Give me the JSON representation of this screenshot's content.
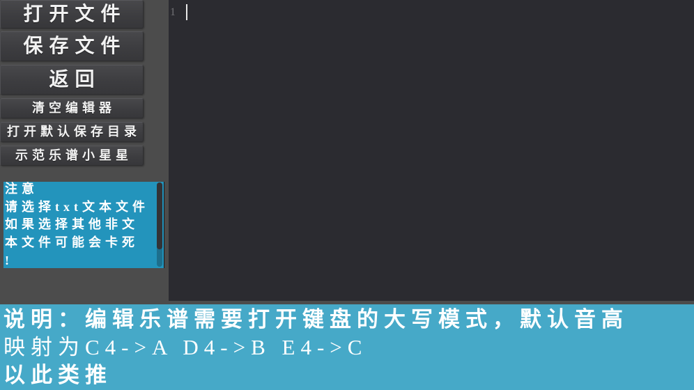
{
  "sidebar": {
    "buttons": [
      {
        "label": "打开文件"
      },
      {
        "label": "保存文件"
      },
      {
        "label": "返回"
      },
      {
        "label": "清空编辑器"
      },
      {
        "label": "打开默认保存目录"
      },
      {
        "label": "示范乐谱小星星"
      }
    ]
  },
  "notice": {
    "lines": [
      "注意",
      "请选择txt文本文件",
      "如果选择其他非文",
      "本文件可能会卡死",
      "!"
    ]
  },
  "editor": {
    "line_numbers": [
      "1"
    ],
    "content": ""
  },
  "info": {
    "lines": [
      "说明：编辑乐谱需要打开键盘的大写模式，默认音高",
      "映射为C4->A D4->B E4->C",
      "以此类推"
    ]
  },
  "colors": {
    "background": "#4c4c4c",
    "button": "#3d3d40",
    "editor": "#2b2b30",
    "notice_bg": "#2394bc",
    "info_bg": "#46a9c8",
    "text": "#ffffff"
  }
}
